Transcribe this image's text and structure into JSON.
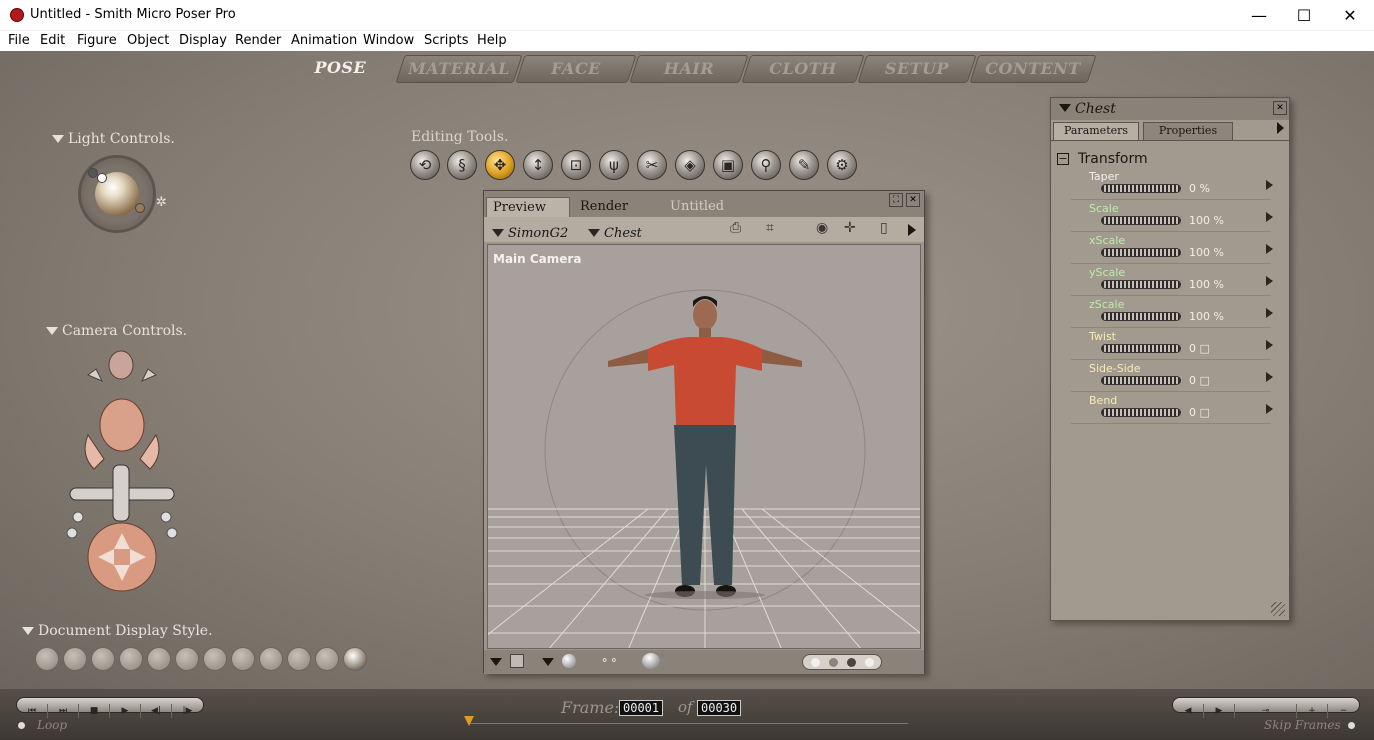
{
  "window": {
    "title": "Untitled - Smith Micro Poser Pro",
    "minimize": "—",
    "maximize": "☐",
    "close": "✕"
  },
  "menu": [
    "File",
    "Edit",
    "Figure",
    "Object",
    "Display",
    "Render",
    "Animation",
    "Window",
    "Scripts",
    "Help"
  ],
  "rooms": [
    "POSE",
    "MATERIAL",
    "FACE",
    "HAIR",
    "CLOTH",
    "SETUP",
    "CONTENT"
  ],
  "active_room": "POSE",
  "light_controls": {
    "label": "Light Controls."
  },
  "editing_tools": {
    "label": "Editing Tools.",
    "tools": [
      "rotate-icon",
      "twist-icon",
      "translate-icon",
      "translate-in-out-icon",
      "scale-icon",
      "taper-icon",
      "chain-break-icon",
      "color-icon",
      "grouping-icon",
      "view-magnifier-icon",
      "morphing-tool-icon",
      "direct-manipulation-icon"
    ],
    "active_tool": "translate-icon"
  },
  "camera_controls": {
    "label": "Camera Controls."
  },
  "document_display_style": {
    "label": "Document Display Style.",
    "styles": 12,
    "active_index": 11
  },
  "document": {
    "tabs": [
      "Preview",
      "Render",
      "Untitled"
    ],
    "active_tab": "Preview",
    "figure_menu": "SimonG2",
    "actor_menu": "Chest",
    "camera_name": "Main Camera"
  },
  "parameters_panel": {
    "title": "Chest",
    "tabs": [
      "Parameters",
      "Properties"
    ],
    "active_tab": "Parameters",
    "group": "Transform",
    "group_toggle": "−",
    "params": [
      {
        "name": "Taper",
        "value": "0 %",
        "color": "#f3efe9",
        "level": 0.5
      },
      {
        "name": "Scale",
        "value": "100 %",
        "color": "#b5f0a8",
        "level": 0.5
      },
      {
        "name": "xScale",
        "value": "100 %",
        "color": "#b5f0a8",
        "level": 0.5
      },
      {
        "name": "yScale",
        "value": "100 %",
        "color": "#b5f0a8",
        "level": 0.5
      },
      {
        "name": "zScale",
        "value": "100 %",
        "color": "#b5f0a8",
        "level": 0.5
      },
      {
        "name": "Twist",
        "value": "0 □",
        "color": "#f6ecb0",
        "level": 0.5
      },
      {
        "name": "Side-Side",
        "value": "0 □",
        "color": "#f6ecb0",
        "level": 0.5
      },
      {
        "name": "Bend",
        "value": "0 □",
        "color": "#f6ecb0",
        "level": 0.5
      }
    ]
  },
  "timeline": {
    "frame_label": "Frame:",
    "current_frame": "00001",
    "of_label": "of",
    "total_frames": "00030",
    "loop_label": "Loop",
    "skip_frames_label": "Skip Frames",
    "play_controls": [
      "⏮",
      "⏭",
      "■",
      "▶",
      "◀|",
      "|▶"
    ],
    "key_controls": [
      "◀",
      "▶",
      "⊸",
      "+",
      "−"
    ]
  }
}
